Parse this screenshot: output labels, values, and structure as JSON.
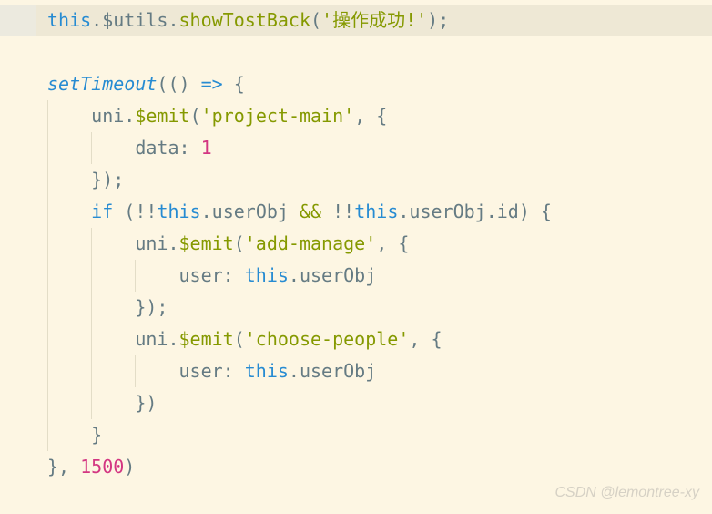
{
  "code": {
    "l1_this": "this",
    "l1_utils": ".$utils.",
    "l1_fn": "showTostBack",
    "l1_open": "(",
    "l1_str": "'操作成功!'",
    "l1_close": ");",
    "l3_fn": "setTimeout",
    "l3_open": "(() ",
    "l3_arrow": "=>",
    "l3_brace": " {",
    "l4_obj": "uni.",
    "l4_fn": "$emit",
    "l4_open": "(",
    "l4_str": "'project-main'",
    "l4_after": ", {",
    "l5_key": "data: ",
    "l5_val": "1",
    "l6": "});",
    "l7_if": "if",
    "l7_open": " (!!",
    "l7_this1": "this",
    "l7_u1": ".userObj ",
    "l7_and": "&&",
    "l7_notnot": " !!",
    "l7_this2": "this",
    "l7_u2": ".userObj.id) {",
    "l8_obj": "uni.",
    "l8_fn": "$emit",
    "l8_open": "(",
    "l8_str": "'add-manage'",
    "l8_after": ", {",
    "l9_key": "user: ",
    "l9_this": "this",
    "l9_u": ".userObj",
    "l10": "});",
    "l11_obj": "uni.",
    "l11_fn": "$emit",
    "l11_open": "(",
    "l11_str": "'choose-people'",
    "l11_after": ", {",
    "l12_key": "user: ",
    "l12_this": "this",
    "l12_u": ".userObj",
    "l13": "})",
    "l14": "}",
    "l15_close": "}, ",
    "l15_num": "1500",
    "l15_end": ")"
  },
  "watermark": "CSDN @lemontree-xy"
}
